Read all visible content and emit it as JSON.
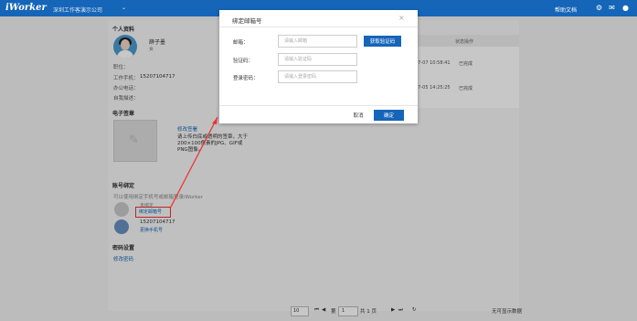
{
  "topbar": {
    "logo": "iWorker",
    "company": "深圳工作客演示公司",
    "help_link": "帮助文档"
  },
  "profile": {
    "section_title": "个人资料",
    "name": "薛子墨",
    "gender": "女",
    "fields": [
      {
        "label": "职位：",
        "value": ""
      },
      {
        "label": "工作手机：",
        "value": "15207104717"
      },
      {
        "label": "办公电话：",
        "value": ""
      },
      {
        "label": "自我描述：",
        "value": ""
      }
    ]
  },
  "signature": {
    "section_title": "电子签章",
    "change_link": "修改签署",
    "desc": "请上传白底或透明的签章，大于200×100像素的JPG、GIF或PNG图像。"
  },
  "binding": {
    "section_title": "账号绑定",
    "hint": "可以使用绑定手机号或邮箱登录iWorker",
    "email_status": "未绑定",
    "bind_email_link": "绑定邮箱号",
    "phone": "15207104717",
    "change_phone_link": "更换手机号"
  },
  "password": {
    "section_title": "密码设置",
    "change_link": "修改密码"
  },
  "right_table": {
    "header": "状态操作",
    "rows": [
      {
        "time": "07-07 10:58:41",
        "status": "已完成"
      },
      {
        "time": "07-05 14:25:25",
        "status": "已完成"
      }
    ]
  },
  "pager": {
    "page_size": "10",
    "page_prefix": "第",
    "page_value": "1",
    "page_suffix": "共 1 页",
    "no_data": "无可显示数据"
  },
  "modal": {
    "title": "绑定邮箱号",
    "close": "×",
    "email_label": "邮箱：",
    "email_placeholder": "请输入邮箱",
    "get_code_button": "获取验证码",
    "code_label": "验证码：",
    "code_placeholder": "请输入验证码",
    "password_label": "登录密码：",
    "password_placeholder": "请输入登录密码",
    "cancel_button": "取消",
    "confirm_button": "确定"
  }
}
